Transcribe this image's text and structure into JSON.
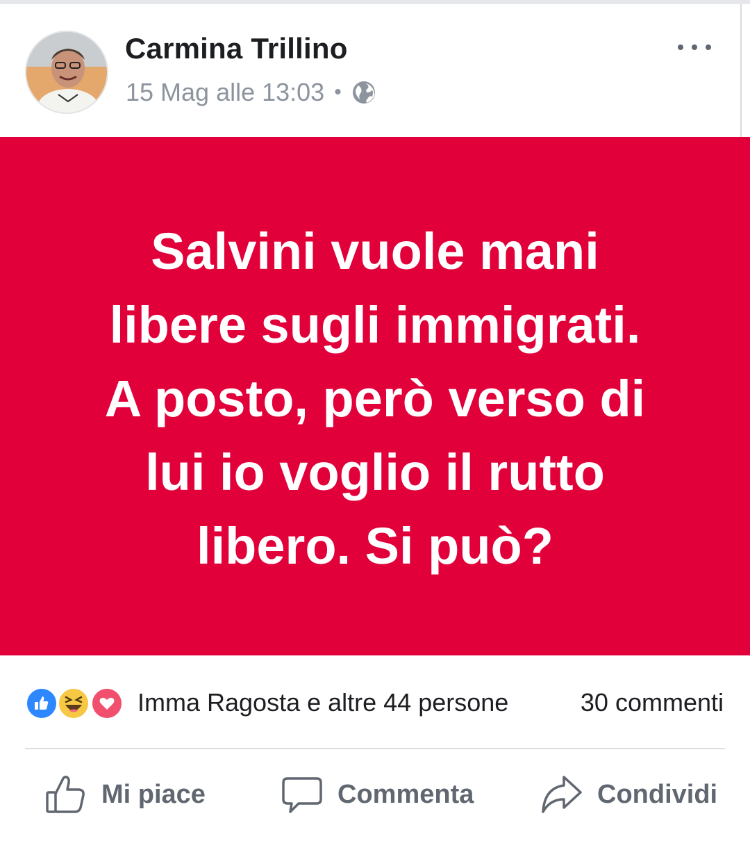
{
  "post": {
    "author": "Carmina Trillino",
    "timestamp": "15 Mag alle 13:03",
    "separator": "•",
    "privacy_icon": "globe-icon",
    "more_icon": "more-options-icon",
    "text_lines": [
      "Salvini vuole mani",
      "libere sugli immigrati.",
      "A posto, però verso di",
      "lui io voglio il rutto",
      "libero. Si può?"
    ],
    "background_color": "#e1003a"
  },
  "reactions": {
    "icons": [
      "like-reaction-icon",
      "haha-reaction-icon",
      "love-reaction-icon"
    ],
    "names": "Imma Ragosta e altre 44 persone",
    "comments": "30 commenti"
  },
  "actions": {
    "like": "Mi piace",
    "comment": "Commenta",
    "share": "Condividi"
  },
  "colors": {
    "accent_like": "#2d88ff",
    "muted_text": "#8d949e",
    "action_text": "#606770"
  }
}
